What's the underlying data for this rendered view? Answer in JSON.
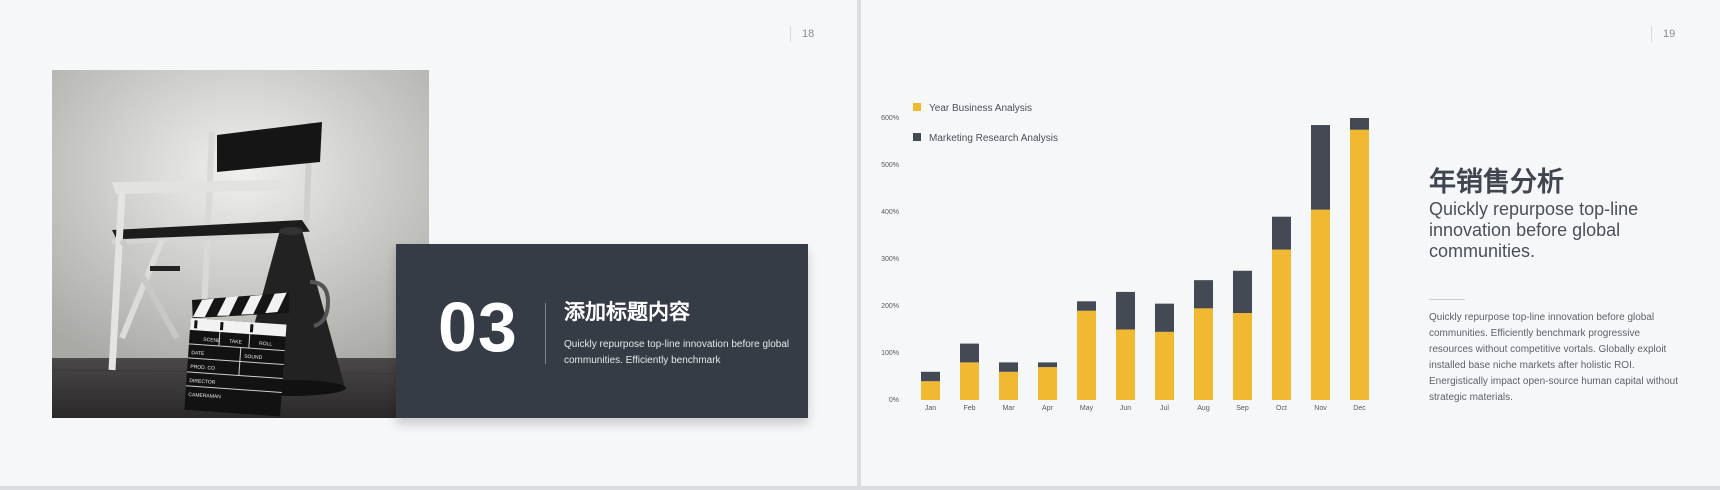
{
  "slide_left": {
    "page_number": "18",
    "section_number": "03",
    "title": "添加标题内容",
    "body": "Quickly repurpose top-line innovation before global communities. Efficiently benchmark",
    "clapper": {
      "scene": "SCENE",
      "take": "TAKE",
      "roll": "ROLL",
      "date": "DATE",
      "prod": "PROD. CO",
      "director": "DIRECTOR",
      "camera": "CAMERAMAN",
      "sound": "SOUND"
    }
  },
  "slide_right": {
    "page_number": "19",
    "title": "年销售分析",
    "subtitle": "Quickly repurpose top-line innovation before global communities.",
    "body": "Quickly repurpose top-line innovation before global communities. Efficiently benchmark progressive resources without competitive vortals. Globally exploit installed base niche markets after holistic ROI. Energistically impact open-source human capital without strategic materials."
  },
  "colors": {
    "yellow": "#f1b932",
    "slate": "#434a54",
    "dark_card": "#353c45"
  },
  "chart_data": {
    "type": "bar",
    "stacked": true,
    "categories": [
      "Jan",
      "Feb",
      "Mar",
      "Apr",
      "May",
      "Jun",
      "Jul",
      "Aug",
      "Sep",
      "Oct",
      "Nov",
      "Dec"
    ],
    "series": [
      {
        "name": "Year Business Analysis",
        "color": "#f1b932",
        "values": [
          40,
          80,
          60,
          70,
          190,
          150,
          145,
          195,
          185,
          320,
          405,
          575
        ]
      },
      {
        "name": "Marketing Research Analysis",
        "color": "#434a54",
        "values": [
          20,
          40,
          20,
          10,
          20,
          80,
          60,
          60,
          90,
          70,
          180,
          25
        ]
      }
    ],
    "yticks": [
      "0%",
      "100%",
      "200%",
      "300%",
      "400%",
      "500%",
      "600%"
    ],
    "ylim": [
      0,
      600
    ],
    "grid": false,
    "legend_position": "top-left"
  }
}
